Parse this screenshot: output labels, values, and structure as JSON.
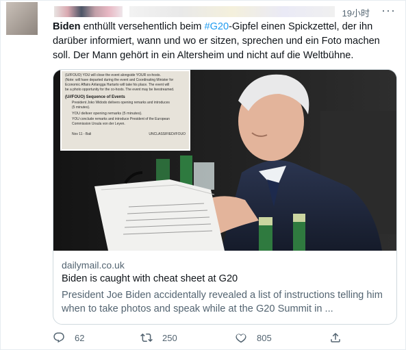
{
  "tweet": {
    "timestamp": "19小时",
    "more_label": "···",
    "text": {
      "bold": "Biden",
      "part1": " enthüllt versehentlich beim ",
      "hashtag": "#G20",
      "part2": "-Gipfel einen Spickzettel, der ihn darüber informiert, wann und wo er sitzen, sprechen und ein Foto machen soll. Der Mann gehört in ein Altersheim und nicht auf die Weltbühne."
    },
    "card": {
      "domain": "dailymail.co.uk",
      "title": "Biden is caught with cheat sheet at G20",
      "description": "President Joe Biden accidentally revealed a list of instructions telling him when to take photos and speak while at the G20 Summit in ...",
      "inset": {
        "lines": [
          "(U//FOUO) YOU will close the event alongside YOUR co-hosts.",
          "(Note: will have departed during the event and Coordinating Minister for",
          "Economic Affairs Airlangga Hartarto will take his place. The event will",
          "be a photo opportunity for the co-hosts. The event may be livestreamed.",
          "(U//FOUO) Sequence of Events",
          "President Joko Widodo delivers opening remarks and introduces",
          "(5 minutes).",
          "YOU deliver opening remarks (5 minutes).",
          "YOU conclude remarks and introduce President of the European",
          "Commission Ursula von der Leyen.",
          "Nov 11 - Bali",
          "UNCLASSIFIED//FOUO"
        ]
      }
    },
    "actions": {
      "reply": {
        "icon": "reply-icon",
        "count": "62"
      },
      "retweet": {
        "icon": "retweet-icon",
        "count": "250"
      },
      "like": {
        "icon": "heart-icon",
        "count": "805"
      },
      "share": {
        "icon": "share-icon"
      }
    }
  },
  "colors": {
    "accent": "#1d9bf0",
    "secondary_text": "#536471",
    "border": "#cfd9de"
  }
}
